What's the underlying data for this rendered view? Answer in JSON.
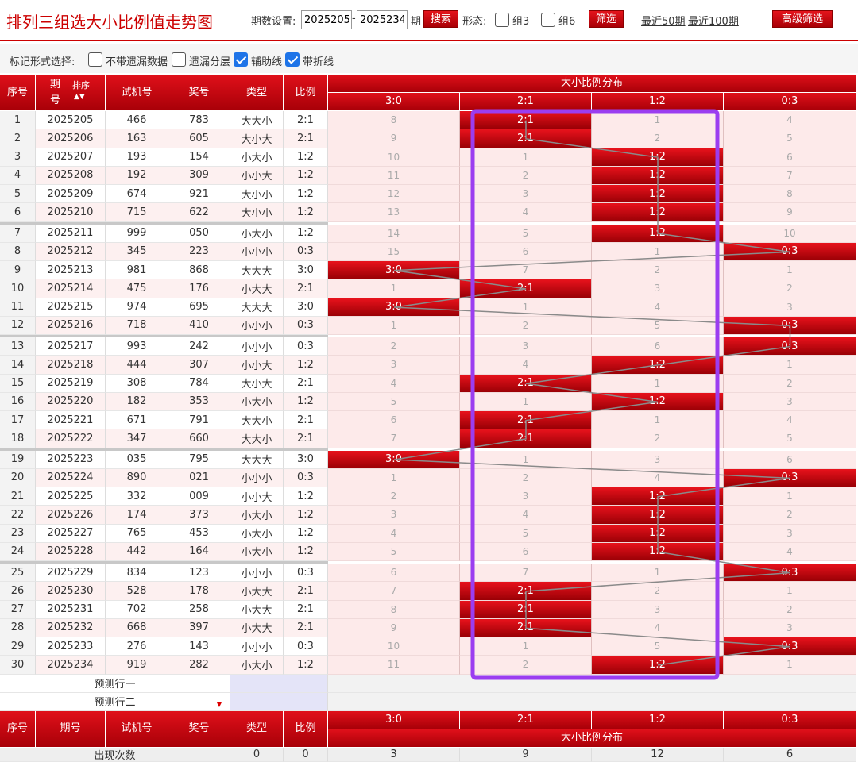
{
  "title": "排列三组选大小比例值走势图",
  "toolbar": {
    "period_label": "期数设置:",
    "from": "2025205",
    "dash": "-",
    "to": "2025234",
    "qi": "期",
    "search": "搜索",
    "shape_label": "形态:",
    "g3": "组3",
    "g6": "组6",
    "filter": "筛选",
    "last50": "最近50期",
    "last100": "最近100期",
    "advanced": "高级筛选"
  },
  "mark": {
    "label": "标记形式选择:",
    "opt1": "不带遗漏数据",
    "opt2": "遗漏分层",
    "opt3": "辅助线",
    "opt4": "带折线",
    "opt3_checked": true,
    "opt4_checked": true
  },
  "headers": {
    "seq": "序号",
    "issue1": "期",
    "issue2": "号",
    "sort": "排序",
    "trial": "试机号",
    "prize": "奖号",
    "type": "类型",
    "ratio": "比例",
    "dist": "大小比例分布",
    "issue": "期号"
  },
  "dist_cols": [
    "3:0",
    "2:1",
    "1:2",
    "0:3"
  ],
  "rows": [
    [
      "1",
      "2025205",
      "466",
      "783",
      "大大小",
      "2:1",
      "8",
      "2:1",
      "1",
      "4"
    ],
    [
      "2",
      "2025206",
      "163",
      "605",
      "大小大",
      "2:1",
      "9",
      "2:1",
      "2",
      "5"
    ],
    [
      "3",
      "2025207",
      "193",
      "154",
      "小大小",
      "1:2",
      "10",
      "1",
      "1:2",
      "6"
    ],
    [
      "4",
      "2025208",
      "192",
      "309",
      "小小大",
      "1:2",
      "11",
      "2",
      "1:2",
      "7"
    ],
    [
      "5",
      "2025209",
      "674",
      "921",
      "大小小",
      "1:2",
      "12",
      "3",
      "1:2",
      "8"
    ],
    [
      "6",
      "2025210",
      "715",
      "622",
      "大小小",
      "1:2",
      "13",
      "4",
      "1:2",
      "9"
    ],
    [
      "7",
      "2025211",
      "999",
      "050",
      "小大小",
      "1:2",
      "14",
      "5",
      "1:2",
      "10"
    ],
    [
      "8",
      "2025212",
      "345",
      "223",
      "小小小",
      "0:3",
      "15",
      "6",
      "1",
      "0:3"
    ],
    [
      "9",
      "2025213",
      "981",
      "868",
      "大大大",
      "3:0",
      "3:0",
      "7",
      "2",
      "1"
    ],
    [
      "10",
      "2025214",
      "475",
      "176",
      "小大大",
      "2:1",
      "1",
      "2:1",
      "3",
      "2"
    ],
    [
      "11",
      "2025215",
      "974",
      "695",
      "大大大",
      "3:0",
      "3:0",
      "1",
      "4",
      "3"
    ],
    [
      "12",
      "2025216",
      "718",
      "410",
      "小小小",
      "0:3",
      "1",
      "2",
      "5",
      "0:3"
    ],
    [
      "13",
      "2025217",
      "993",
      "242",
      "小小小",
      "0:3",
      "2",
      "3",
      "6",
      "0:3"
    ],
    [
      "14",
      "2025218",
      "444",
      "307",
      "小小大",
      "1:2",
      "3",
      "4",
      "1:2",
      "1"
    ],
    [
      "15",
      "2025219",
      "308",
      "784",
      "大小大",
      "2:1",
      "4",
      "2:1",
      "1",
      "2"
    ],
    [
      "16",
      "2025220",
      "182",
      "353",
      "小大小",
      "1:2",
      "5",
      "1",
      "1:2",
      "3"
    ],
    [
      "17",
      "2025221",
      "671",
      "791",
      "大大小",
      "2:1",
      "6",
      "2:1",
      "1",
      "4"
    ],
    [
      "18",
      "2025222",
      "347",
      "660",
      "大大小",
      "2:1",
      "7",
      "2:1",
      "2",
      "5"
    ],
    [
      "19",
      "2025223",
      "035",
      "795",
      "大大大",
      "3:0",
      "3:0",
      "1",
      "3",
      "6"
    ],
    [
      "20",
      "2025224",
      "890",
      "021",
      "小小小",
      "0:3",
      "1",
      "2",
      "4",
      "0:3"
    ],
    [
      "21",
      "2025225",
      "332",
      "009",
      "小小大",
      "1:2",
      "2",
      "3",
      "1:2",
      "1"
    ],
    [
      "22",
      "2025226",
      "174",
      "373",
      "小大小",
      "1:2",
      "3",
      "4",
      "1:2",
      "2"
    ],
    [
      "23",
      "2025227",
      "765",
      "453",
      "小大小",
      "1:2",
      "4",
      "5",
      "1:2",
      "3"
    ],
    [
      "24",
      "2025228",
      "442",
      "164",
      "小大小",
      "1:2",
      "5",
      "6",
      "1:2",
      "4"
    ],
    [
      "25",
      "2025229",
      "834",
      "123",
      "小小小",
      "0:3",
      "6",
      "7",
      "1",
      "0:3"
    ],
    [
      "26",
      "2025230",
      "528",
      "178",
      "小大大",
      "2:1",
      "7",
      "2:1",
      "2",
      "1"
    ],
    [
      "27",
      "2025231",
      "702",
      "258",
      "小大大",
      "2:1",
      "8",
      "2:1",
      "3",
      "2"
    ],
    [
      "28",
      "2025232",
      "668",
      "397",
      "小大大",
      "2:1",
      "9",
      "2:1",
      "4",
      "3"
    ],
    [
      "29",
      "2025233",
      "276",
      "143",
      "小小小",
      "0:3",
      "10",
      "1",
      "5",
      "0:3"
    ],
    [
      "30",
      "2025234",
      "919",
      "282",
      "小大小",
      "1:2",
      "11",
      "2",
      "1:2",
      "1"
    ]
  ],
  "predict": [
    "预测行一",
    "预测行二"
  ],
  "footer": {
    "count_label": "出现次数",
    "counts": [
      "0",
      "0",
      "3",
      "9",
      "12",
      "6"
    ]
  },
  "colors": {
    "accent": "#c00000",
    "highlight_box": "#9b3df0",
    "checkbox": "#1e74e8"
  }
}
